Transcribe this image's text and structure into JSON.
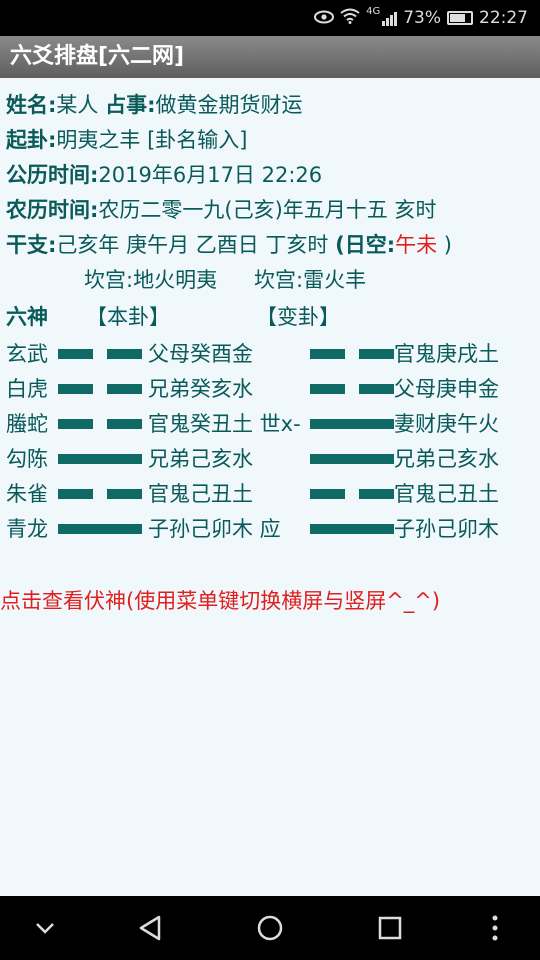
{
  "status": {
    "network": "4G",
    "battery": "73%",
    "battery_fraction": 0.73,
    "time": "22:27"
  },
  "app": {
    "title": "六爻排盘[六二网]"
  },
  "info": {
    "name_label": "姓名:",
    "name_value": "某人",
    "matter_label": "占事:",
    "matter_value": "做黄金期货财运",
    "qigua_label": "起卦:",
    "qigua_value": "明夷之丰 [卦名输入]",
    "gongli_label": "公历时间:",
    "gongli_value": "2019年6月17日 22:26",
    "nongli_label": "农历时间:",
    "nongli_value": "农历二零一九(己亥)年五月十五 亥时",
    "ganzhi_label": "干支:",
    "ganzhi_value": "己亥年 庚午月 乙酉日 丁亥时 ",
    "rikong_open": "(",
    "rikong_label": "日空:",
    "rikong_value": "午未",
    "rikong_close": " )"
  },
  "palaces": {
    "ben": "坎宫:地火明夷",
    "bian": "坎宫:雷火丰"
  },
  "header": {
    "liushen": "六神",
    "bengua": "【本卦】",
    "biangua": "【变卦】"
  },
  "lines": [
    {
      "shen": "玄武",
      "ben_type": "yin",
      "ben_text": "父母癸酉金",
      "bian_type": "yin",
      "bian_text": "官鬼庚戌土"
    },
    {
      "shen": "白虎",
      "ben_type": "yin",
      "ben_text": "兄弟癸亥水",
      "bian_type": "yin",
      "bian_text": "父母庚申金"
    },
    {
      "shen": "螣蛇",
      "ben_type": "yin",
      "ben_text": "官鬼癸丑土 世x-",
      "bian_type": "yang",
      "bian_text": "妻财庚午火"
    },
    {
      "shen": "勾陈",
      "ben_type": "yang",
      "ben_text": "兄弟己亥水",
      "bian_type": "yang",
      "bian_text": "兄弟己亥水"
    },
    {
      "shen": "朱雀",
      "ben_type": "yin",
      "ben_text": "官鬼己丑土",
      "bian_type": "yin",
      "bian_text": "官鬼己丑土"
    },
    {
      "shen": "青龙",
      "ben_type": "yang",
      "ben_text": "子孙己卯木 应",
      "bian_type": "yang",
      "bian_text": "子孙己卯木"
    }
  ],
  "fushen_link": "点击查看伏神(使用菜单键切换横屏与竖屏^_^)",
  "colors": {
    "accent_red": "#e0201e",
    "text_teal": "#0a5a5a",
    "bar": "#0f6a66",
    "content_bg": "#f0f8fc"
  },
  "nav": {
    "icons": [
      "chevron-down-icon",
      "back-icon",
      "home-icon",
      "recents-icon",
      "more-icon"
    ]
  }
}
